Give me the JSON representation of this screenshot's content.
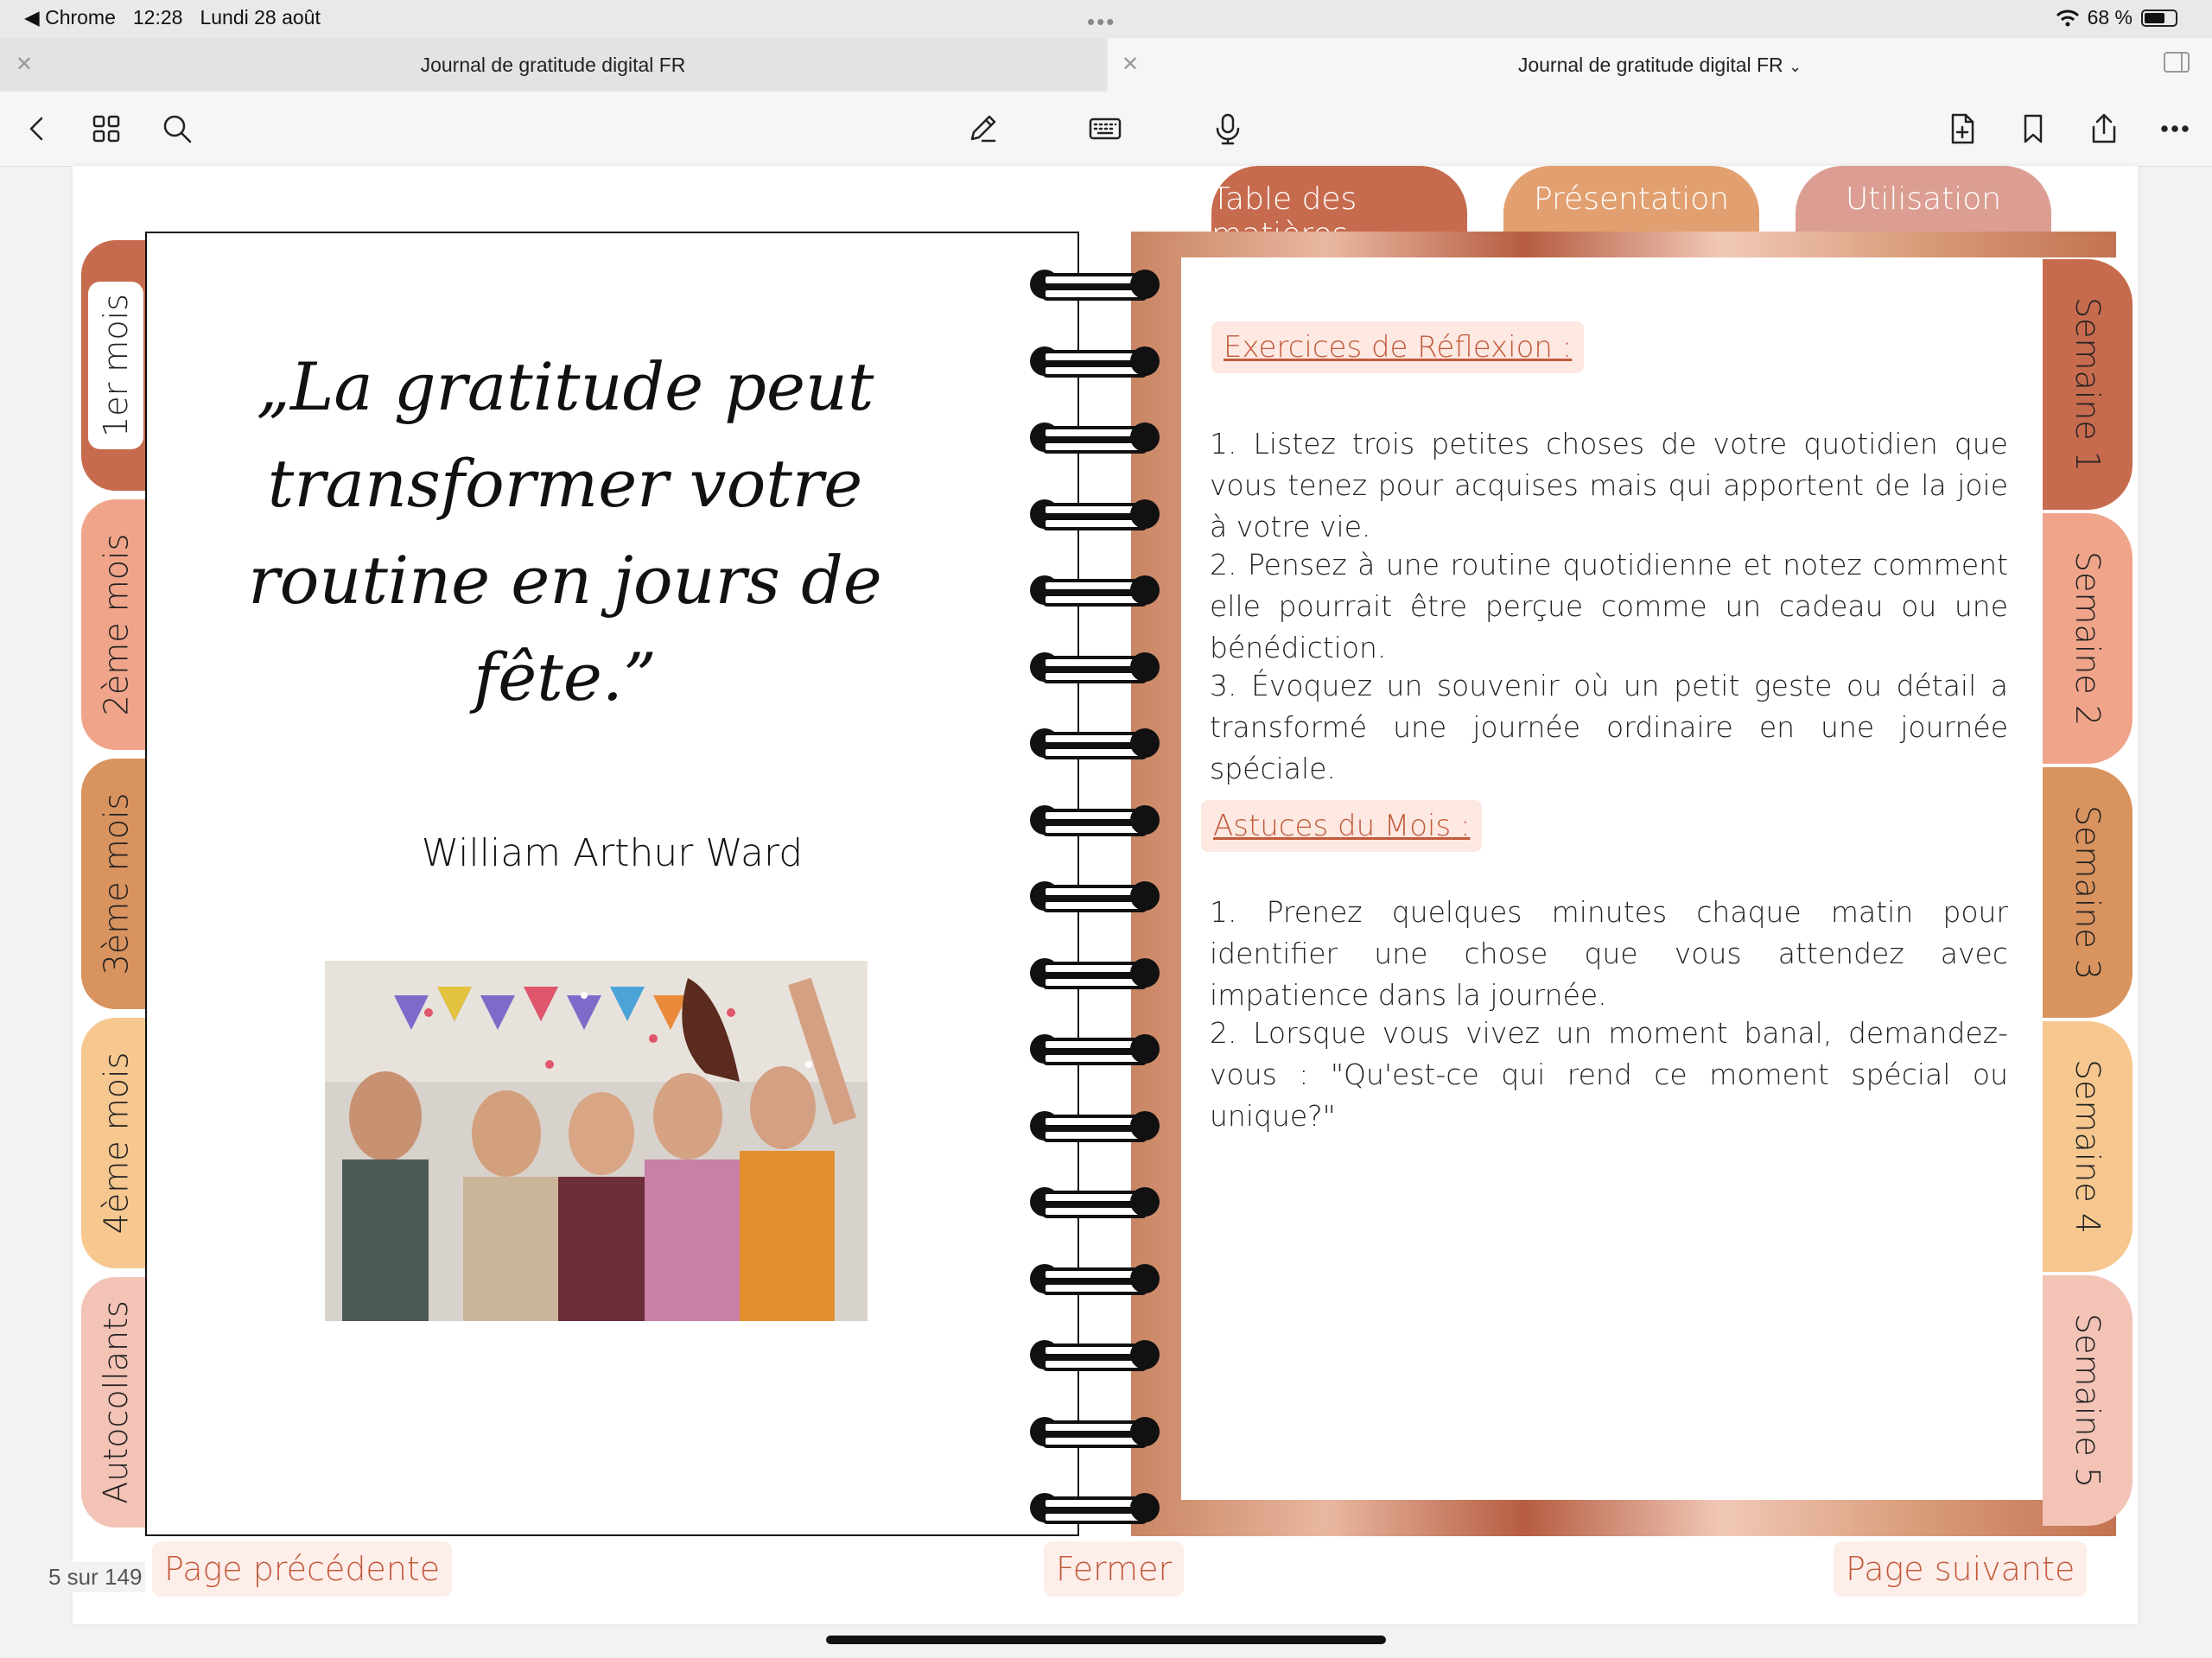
{
  "status": {
    "back_app": "Chrome",
    "time": "12:28",
    "date": "Lundi 28 août",
    "battery": "68 %",
    "battery_level": 0.68
  },
  "tabs": [
    {
      "title": "Journal de gratitude digital FR"
    },
    {
      "title": "Journal de gratitude digital FR"
    }
  ],
  "toolbar": {
    "left": [
      "back-icon",
      "grid-icon",
      "search-icon"
    ],
    "center": [
      "pen-icon",
      "keyboard-icon",
      "microphone-icon"
    ],
    "right": [
      "add-page-icon",
      "bookmark-icon",
      "share-icon",
      "more-icon"
    ]
  },
  "top_tabs": [
    "Table des matières",
    "Présentation",
    "Utilisation"
  ],
  "month_tabs": [
    "1er mois",
    "2ème mois",
    "3ème mois",
    "4ème mois",
    "Autocollants"
  ],
  "week_tabs": [
    "Semaine 1",
    "Semaine 2",
    "Semaine 3",
    "Semaine 4",
    "Semaine 5"
  ],
  "quote": {
    "text": "„La gratitude peut transformer votre routine en jours de fête.”",
    "author": "William Arthur Ward"
  },
  "exercises": {
    "heading": "Exercices de Réflexion :",
    "items": [
      "1. Listez trois petites choses de votre quotidien que vous tenez pour acquises mais qui apportent de la joie à votre vie.",
      "2. Pensez à une routine quotidienne et notez comment elle pourrait être perçue comme un cadeau ou une bénédiction.",
      "3. Évoquez un souvenir où un petit geste ou détail a transformé une journée ordinaire en une journée spéciale."
    ]
  },
  "tips": {
    "heading": "Astuces du Mois :",
    "items": [
      "1. Prenez quelques minutes chaque matin pour identifier une chose que vous attendez avec impatience dans la journée.",
      "2. Lorsque vous vivez un moment banal, demandez-vous : \"Qu'est-ce qui rend ce moment spécial ou unique?\""
    ]
  },
  "footer": {
    "prev": "Page précédente",
    "close": "Fermer",
    "next": "Page suivante",
    "page_count": "5 sur 149"
  },
  "colors": {
    "accent_text": "#c25a3c",
    "month1": "#c76b4e",
    "month2": "#f0a58a",
    "month3": "#d9935f",
    "month4": "#f6c78f",
    "stickers": "#f3c3b6"
  }
}
